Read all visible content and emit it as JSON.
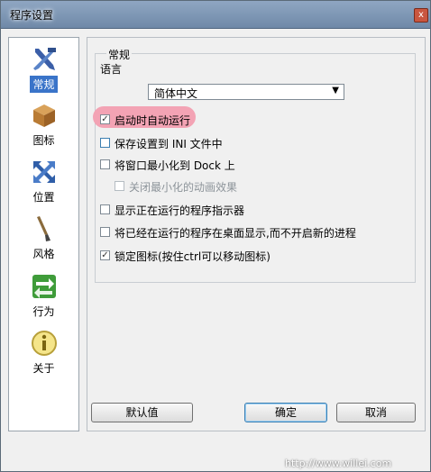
{
  "window": {
    "title": "程序设置",
    "close_label": "x"
  },
  "sidebar": {
    "items": [
      {
        "label": "常规",
        "icon": "tools-icon",
        "selected": true
      },
      {
        "label": "图标",
        "icon": "box-icon",
        "selected": false
      },
      {
        "label": "位置",
        "icon": "move-arrows-icon",
        "selected": false
      },
      {
        "label": "风格",
        "icon": "brush-icon",
        "selected": false
      },
      {
        "label": "行为",
        "icon": "exchange-arrows-icon",
        "selected": false
      },
      {
        "label": "关于",
        "icon": "info-icon",
        "selected": false
      }
    ]
  },
  "general": {
    "group_title": "常规",
    "language_label": "语言",
    "language_value": "简体中文",
    "options": [
      {
        "label": "启动时自动运行",
        "checked": true,
        "enabled": true
      },
      {
        "label": "保存设置到 INI 文件中",
        "checked": false,
        "enabled": true
      },
      {
        "label": "将窗口最小化到 Dock 上",
        "checked": false,
        "enabled": true
      },
      {
        "label": "关闭最小化的动画效果",
        "checked": false,
        "enabled": false
      },
      {
        "label": "显示正在运行的程序指示器",
        "checked": false,
        "enabled": true
      },
      {
        "label": "将已经在运行的程序在桌面显示,而不开启新的进程",
        "checked": false,
        "enabled": true
      },
      {
        "label": "锁定图标(按住ctrl可以移动图标)",
        "checked": true,
        "enabled": true
      }
    ]
  },
  "buttons": {
    "default_label": "默认值",
    "ok_label": "确定",
    "cancel_label": "取消"
  },
  "watermark": "http://www.willei.com",
  "colors": {
    "selection": "#3a74c9",
    "highlight": "#f3a3b4"
  }
}
